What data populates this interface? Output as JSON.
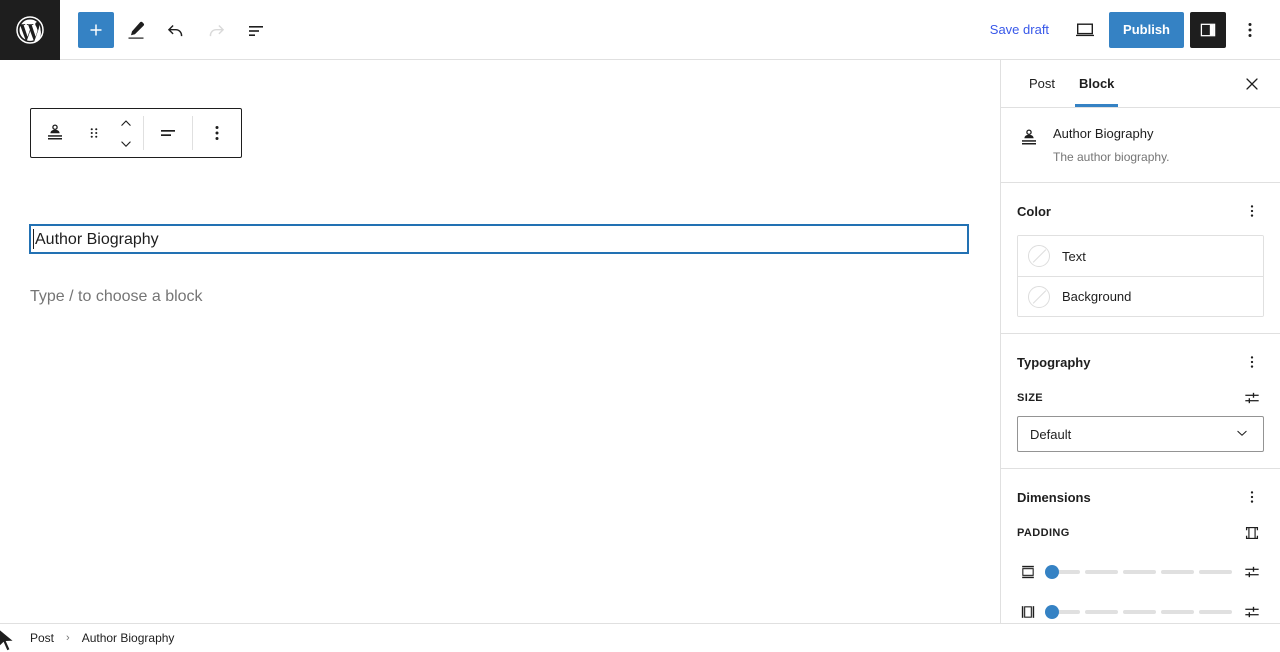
{
  "header": {
    "logo_icon": "wordpress-logo-icon",
    "add_block_label": "+",
    "add_block_icon": "plus-icon",
    "tools_icon": "pencil-edit-icon",
    "undo_icon": "undo-arrow-icon",
    "redo_icon": "redo-arrow-icon",
    "list_view_icon": "list-view-icon",
    "save_draft_label": "Save draft",
    "preview_icon": "desktop-preview-icon",
    "publish_label": "Publish",
    "settings_icon": "settings-sidebar-icon",
    "more_options_icon": "more-vertical-icon"
  },
  "block_toolbar": {
    "block_type_icon": "author-biography-icon",
    "drag_icon": "drag-handle-icon",
    "move_up_icon": "chevron-up-icon",
    "move_down_icon": "chevron-down-icon",
    "align_icon": "align-text-icon",
    "more_icon": "more-vertical-icon"
  },
  "canvas": {
    "selected_block_text": "Author Biography",
    "placeholder_text": "Type / to choose a block"
  },
  "sidebar": {
    "tabs": [
      {
        "label": "Post",
        "active": false
      },
      {
        "label": "Block",
        "active": true
      }
    ],
    "close_icon": "close-x-icon",
    "block_card": {
      "icon": "author-biography-icon",
      "title": "Author Biography",
      "description": "The author biography."
    },
    "panels": [
      {
        "id": "color",
        "title": "Color",
        "options_icon": "more-vertical-icon",
        "rows": [
          {
            "label": "Text",
            "swatch_icon": "no-color-swatch-icon",
            "value": ""
          },
          {
            "label": "Background",
            "swatch_icon": "no-color-swatch-icon",
            "value": ""
          }
        ]
      },
      {
        "id": "typography",
        "title": "Typography",
        "options_icon": "more-vertical-icon",
        "size_label": "SIZE",
        "size_tools_icon": "sliders-toggle-icon",
        "size_value": "Default",
        "size_caret_icon": "chevron-down-icon"
      },
      {
        "id": "dimensions",
        "title": "Dimensions",
        "options_icon": "more-vertical-icon",
        "padding_label": "PADDING",
        "padding_link_icon": "padding-all-sides-icon",
        "sliders": [
          {
            "name": "vertical-padding",
            "icon": "padding-vertical-icon",
            "value": 0,
            "min": 0,
            "max": 5,
            "segments": 5,
            "tools_icon": "sliders-toggle-icon"
          },
          {
            "name": "horizontal-padding",
            "icon": "padding-horizontal-icon",
            "value": 0,
            "min": 0,
            "max": 5,
            "segments": 5,
            "tools_icon": "sliders-toggle-icon"
          }
        ]
      }
    ]
  },
  "footer": {
    "breadcrumbs": [
      "Post",
      "Author Biography"
    ],
    "separator": "›"
  },
  "colors": {
    "accent_blue": "#3582c4",
    "link_blue": "#3858e9",
    "selection_blue": "#2271b3",
    "dark": "#1e1e1e",
    "border": "#e0e0e0",
    "muted_text": "#757575"
  }
}
